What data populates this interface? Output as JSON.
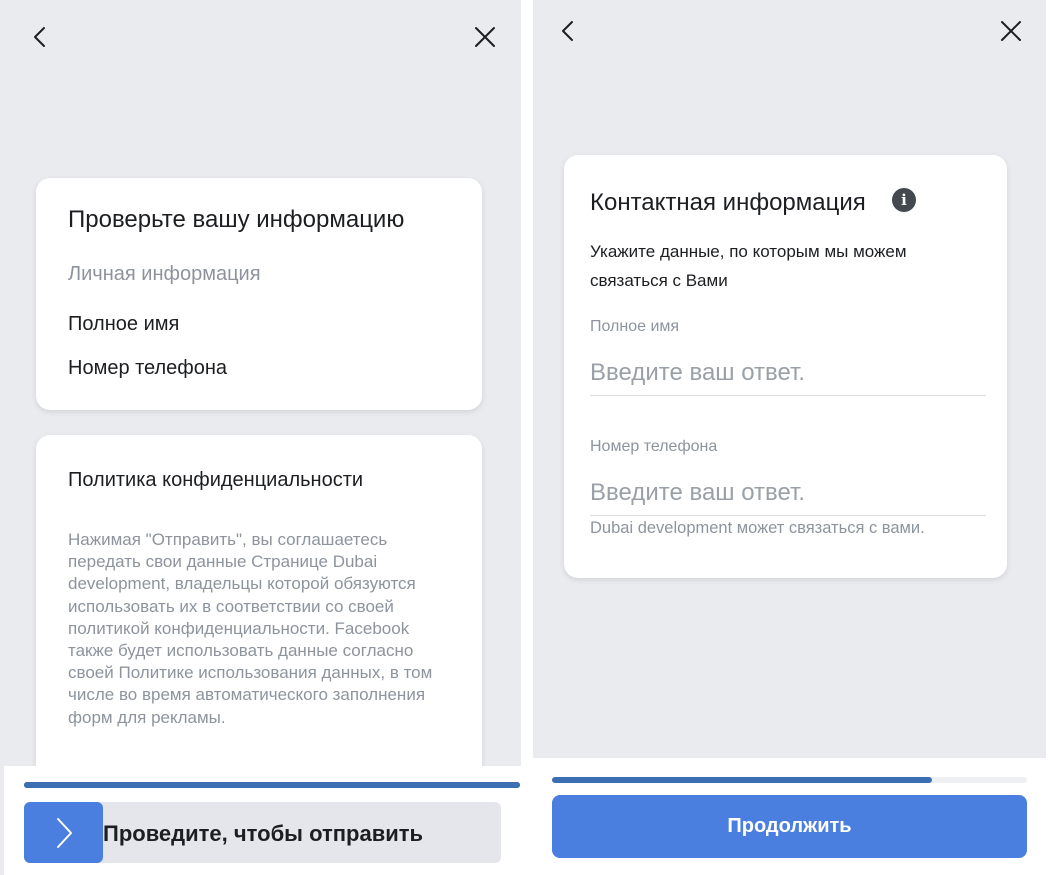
{
  "left": {
    "nav": {
      "back_icon": "chevron-left-icon",
      "close_icon": "close-icon"
    },
    "review_card": {
      "title": "Проверьте вашу информацию",
      "section": "Личная информация",
      "fields": [
        "Полное имя",
        "Номер телефона"
      ]
    },
    "policy_card": {
      "title": "Политика конфиденциальности",
      "body": "Нажимая \"Отправить\", вы соглашаетесь передать свои данные Странице Dubai development, владельцы которой обязуются использовать их в соответствии со своей политикой конфиденциальности. Facebook также будет использовать данные согласно своей Политике использования данных, в том числе во время автоматического заполнения форм для рекламы."
    },
    "progress": {
      "value": 1.0
    },
    "swipe": {
      "label": "Проведите, чтобы отправить",
      "handle_icon": "chevron-right-icon"
    }
  },
  "right": {
    "nav": {
      "back_icon": "chevron-left-icon",
      "close_icon": "close-icon"
    },
    "contact_card": {
      "title": "Контактная информация",
      "info_icon": "info-icon",
      "description": "Укажите данные, по которым мы можем связаться с Вами",
      "fields": [
        {
          "label": "Полное имя",
          "placeholder": "Введите ваш ответ.",
          "value": ""
        },
        {
          "label": "Номер телефона",
          "placeholder": "Введите ваш ответ.",
          "value": ""
        }
      ],
      "helper": "Dubai development может связаться с вами."
    },
    "progress": {
      "value": 0.8
    },
    "continue_label": "Продолжить"
  },
  "colors": {
    "background": "#e9ebee",
    "card": "#ffffff",
    "accent": "#4a7fe0",
    "progress": "#3b6eb3",
    "muted_text": "#8d949e"
  }
}
